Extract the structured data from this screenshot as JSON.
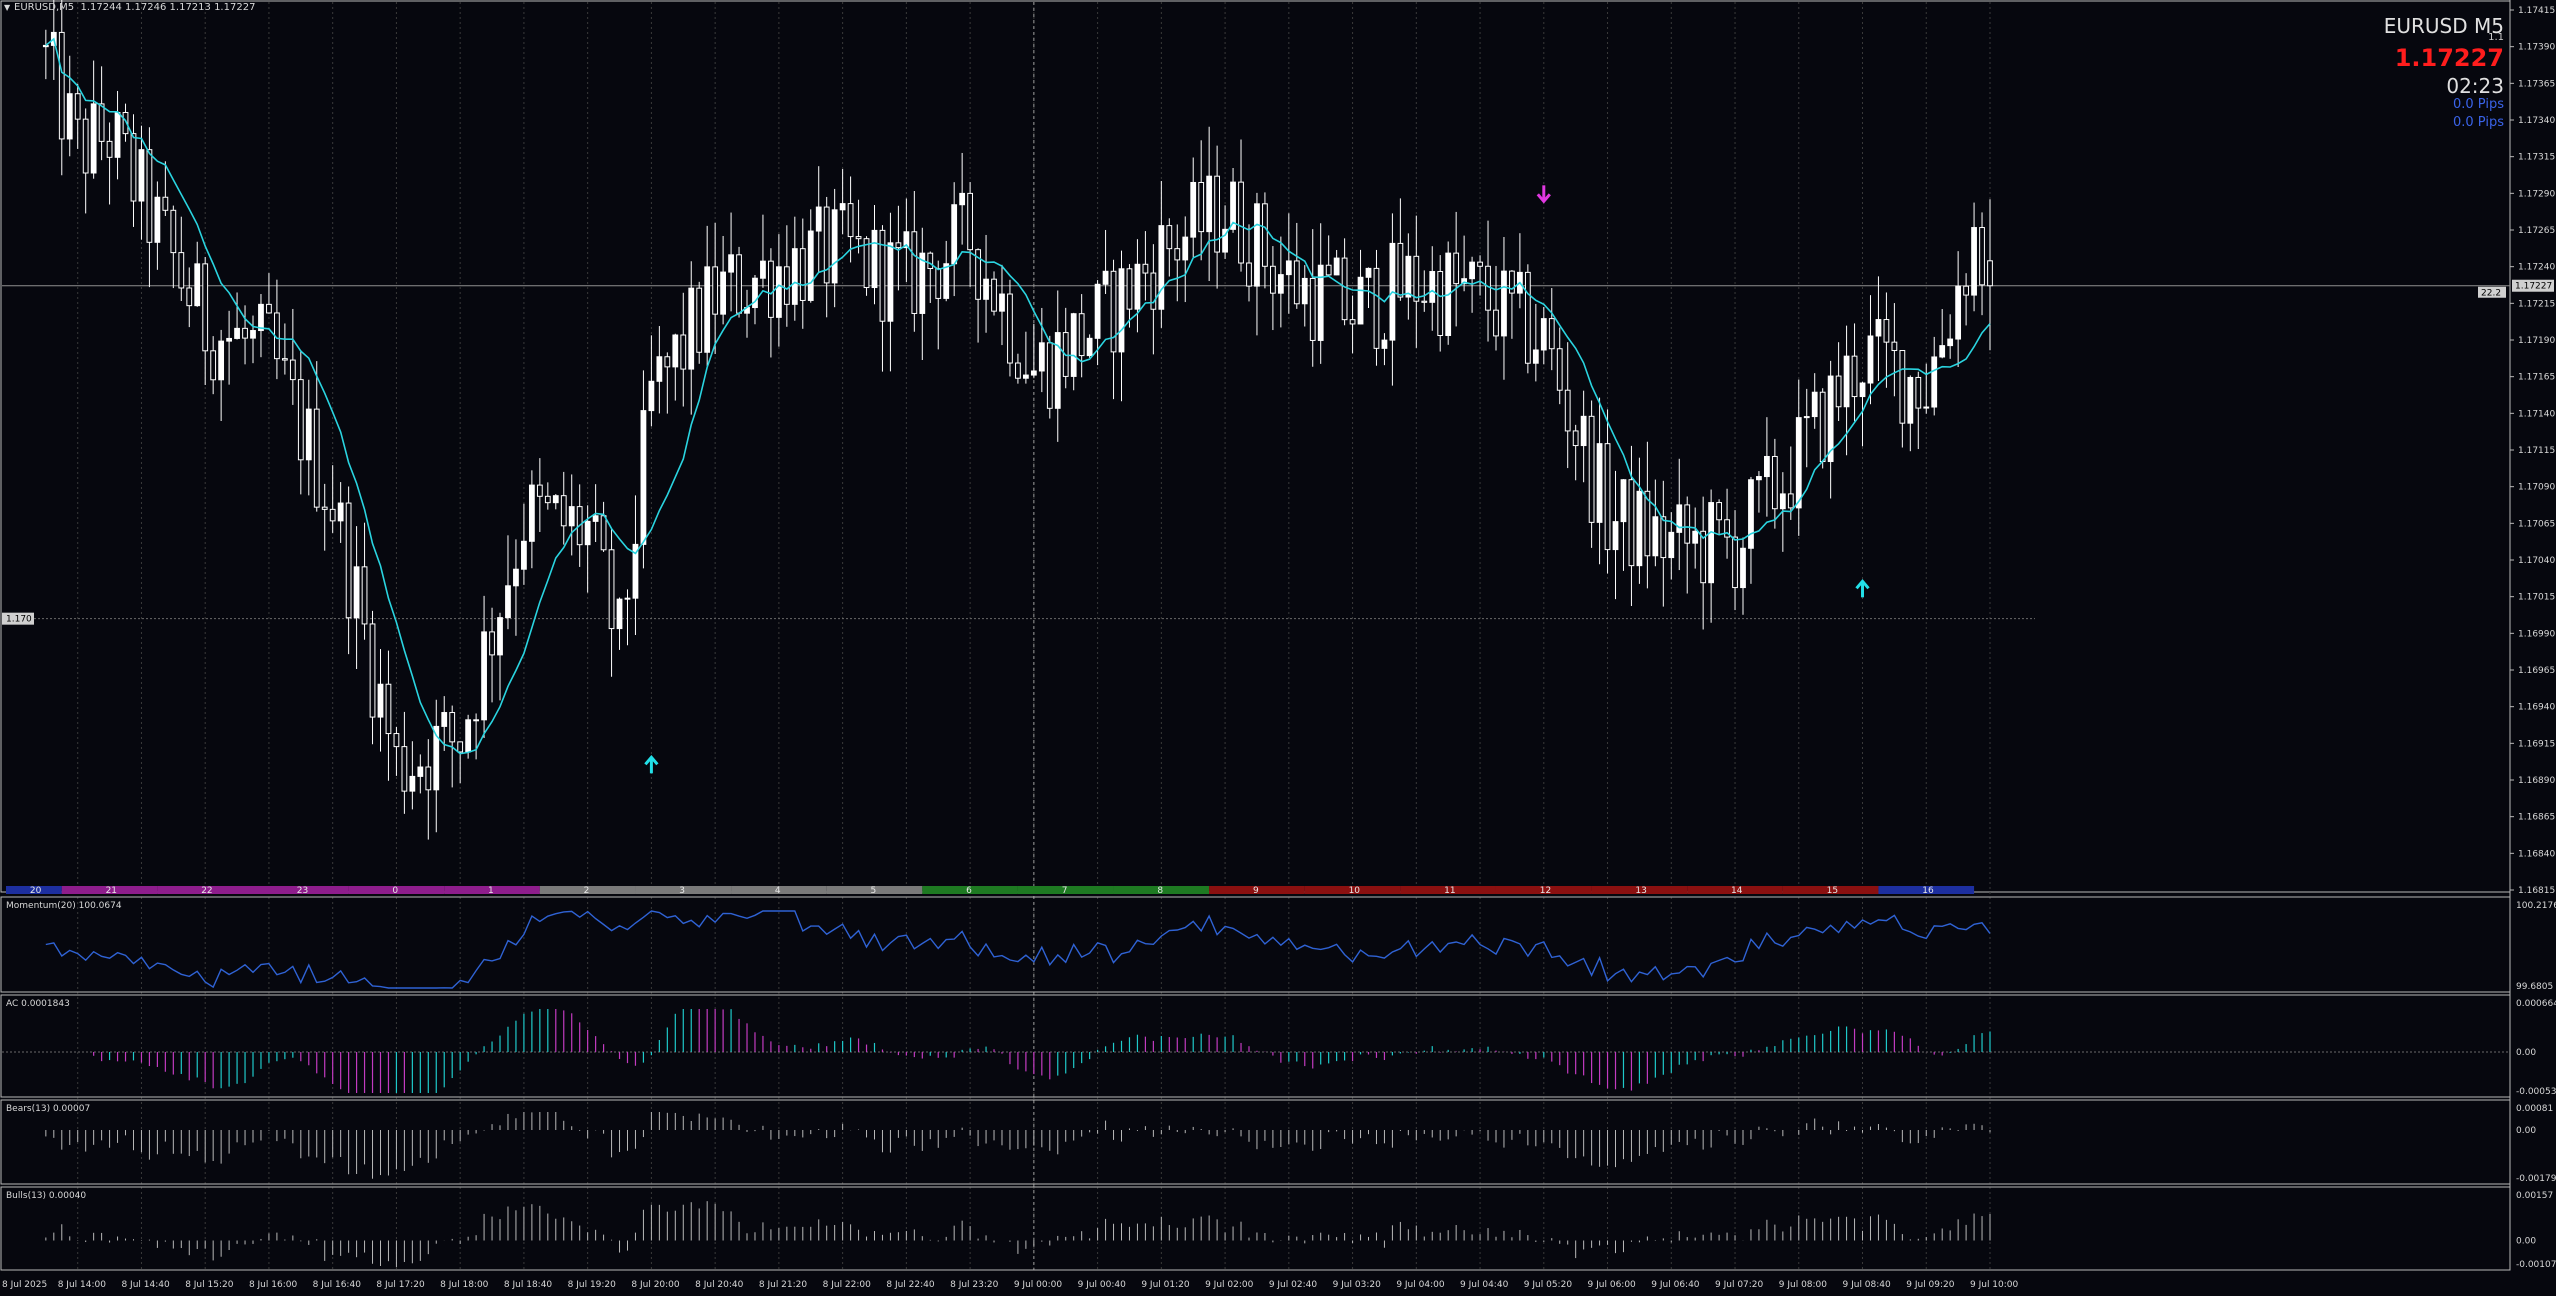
{
  "header": {
    "title": "EURUSD,M5  1.17244 1.17246 1.17213 1.17227"
  },
  "info_panel": {
    "symbol": "EURUSD   M5",
    "spread": "1.1",
    "bid": "1.17227",
    "countdown": "02:23",
    "pips_1": "0.0 Pips",
    "pips_2": "0.0 Pips"
  },
  "level_labels": {
    "horizontal_line": "1.170",
    "price_tag": "1.17227",
    "marker_tag": "22.2"
  },
  "price_axis_labels": [
    "1.17415",
    "1.17390",
    "1.17365",
    "1.17340",
    "1.17315",
    "1.17290",
    "1.17265",
    "1.17240",
    "1.17215",
    "1.17190",
    "1.17165",
    "1.17140",
    "1.17115",
    "1.17090",
    "1.17065",
    "1.17040",
    "1.17015",
    "1.16990",
    "1.16965",
    "1.16940",
    "1.16915",
    "1.16890",
    "1.16865",
    "1.16840",
    "1.16815"
  ],
  "time_axis_labels": [
    "8 Jul 2025",
    "8 Jul 14:00",
    "8 Jul 14:40",
    "8 Jul 15:20",
    "8 Jul 16:00",
    "8 Jul 16:40",
    "8 Jul 17:20",
    "8 Jul 18:00",
    "8 Jul 18:40",
    "8 Jul 19:20",
    "8 Jul 20:00",
    "8 Jul 20:40",
    "8 Jul 21:20",
    "8 Jul 22:00",
    "8 Jul 22:40",
    "8 Jul 23:20",
    "9 Jul 00:00",
    "9 Jul 00:40",
    "9 Jul 01:20",
    "9 Jul 02:00",
    "9 Jul 02:40",
    "9 Jul 03:20",
    "9 Jul 04:00",
    "9 Jul 04:40",
    "9 Jul 05:20",
    "9 Jul 06:00",
    "9 Jul 06:40",
    "9 Jul 07:20",
    "9 Jul 08:00",
    "9 Jul 08:40",
    "9 Jul 09:20",
    "9 Jul 10:00"
  ],
  "hour_bar": {
    "labels": [
      "20",
      "21",
      "22",
      "23",
      "0",
      "1",
      "2",
      "3",
      "4",
      "5",
      "6",
      "7",
      "8",
      "9",
      "10",
      "11",
      "12",
      "13",
      "14",
      "15",
      "16"
    ],
    "colors": [
      "#1d2fa0",
      "#8e1d8c",
      "#8e1d8c",
      "#8e1d8c",
      "#8e1d8c",
      "#8e1d8c",
      "#7a7a7a",
      "#7a7a7a",
      "#7a7a7a",
      "#7a7a7a",
      "#1e7a22",
      "#1e7a22",
      "#1e7a22",
      "#8b1010",
      "#8b1010",
      "#8b1010",
      "#8b1010",
      "#8b1010",
      "#8b1010",
      "#8b1010",
      "#1d2fa0"
    ]
  },
  "indicators": {
    "momentum": {
      "label": "Momentum(20) 100.0674",
      "scale_top": "100.2176",
      "scale_bottom": "99.6805"
    },
    "ac": {
      "label": "AC 0.0001843",
      "scale_top": "0.000664",
      "scale_zero": "0.00",
      "scale_bottom": "-0.000531"
    },
    "bears": {
      "label": "Bears(13) 0.00007",
      "scale_top": "0.00081",
      "scale_zero": "0.00",
      "scale_bottom": "-0.00179"
    },
    "bulls": {
      "label": "Bulls(13) 0.00040",
      "scale_top": "0.00157",
      "scale_zero": "0.00",
      "scale_bottom": "-0.00107"
    }
  },
  "colors": {
    "background": "#06070e",
    "bull_candle": "#ffffff",
    "bear_candle": "#ffffff",
    "moving_average": "#2ad4e0",
    "momentum_line": "#2f62d4",
    "ac_up": "#1fc9c9",
    "ac_down": "#c23bc0",
    "histogram": "#b8b8b8",
    "bid_text": "#ff1d1d",
    "sell_arrow": "#e038e0",
    "buy_arrow": "#22e0e8"
  },
  "chart_data": {
    "type": "candlestick",
    "symbol": "EURUSD",
    "timeframe": "M5",
    "last": {
      "open": 1.17244,
      "high": 1.17246,
      "low": 1.17213,
      "close": 1.17227
    },
    "ylim": [
      1.16815,
      1.17415
    ],
    "key_points": [
      {
        "t": "8 Jul 13:40",
        "price": 1.1738
      },
      {
        "t": "8 Jul 14:00",
        "price": 1.1732
      },
      {
        "t": "8 Jul 14:20",
        "price": 1.1733
      },
      {
        "t": "8 Jul 15:20",
        "price": 1.172
      },
      {
        "t": "8 Jul 16:00",
        "price": 1.1718
      },
      {
        "t": "8 Jul 16:40",
        "price": 1.1708
      },
      {
        "t": "8 Jul 17:20",
        "price": 1.169
      },
      {
        "t": "8 Jul 18:00",
        "price": 1.1692
      },
      {
        "t": "8 Jul 18:40",
        "price": 1.1707
      },
      {
        "t": "8 Jul 19:20",
        "price": 1.1706
      },
      {
        "t": "8 Jul 19:40",
        "price": 1.1698
      },
      {
        "t": "8 Jul 20:00",
        "price": 1.1715
      },
      {
        "t": "8 Jul 20:40",
        "price": 1.1722
      },
      {
        "t": "8 Jul 21:20",
        "price": 1.1724
      },
      {
        "t": "8 Jul 22:00",
        "price": 1.1725
      },
      {
        "t": "8 Jul 22:40",
        "price": 1.1723
      },
      {
        "t": "8 Jul 23:20",
        "price": 1.1726
      },
      {
        "t": "9 Jul 00:00",
        "price": 1.1717
      },
      {
        "t": "9 Jul 00:40",
        "price": 1.172
      },
      {
        "t": "9 Jul 01:20",
        "price": 1.1725
      },
      {
        "t": "9 Jul 02:00",
        "price": 1.1728
      },
      {
        "t": "9 Jul 02:40",
        "price": 1.1723
      },
      {
        "t": "9 Jul 03:20",
        "price": 1.1721
      },
      {
        "t": "9 Jul 04:00",
        "price": 1.1723
      },
      {
        "t": "9 Jul 04:40",
        "price": 1.1722
      },
      {
        "t": "9 Jul 05:20",
        "price": 1.1719
      },
      {
        "t": "9 Jul 06:00",
        "price": 1.1707
      },
      {
        "t": "9 Jul 06:40",
        "price": 1.1705
      },
      {
        "t": "9 Jul 07:20",
        "price": 1.1705
      },
      {
        "t": "9 Jul 08:00",
        "price": 1.1711
      },
      {
        "t": "9 Jul 08:40",
        "price": 1.1718
      },
      {
        "t": "9 Jul 09:20",
        "price": 1.1716
      },
      {
        "t": "9 Jul 09:50",
        "price": 1.1726
      },
      {
        "t": "9 Jul 10:00",
        "price": 1.17227
      }
    ],
    "signals": [
      {
        "type": "buy",
        "t": "8 Jul 20:00",
        "price": 1.169
      },
      {
        "type": "sell",
        "t": "9 Jul 05:20",
        "price": 1.1729
      },
      {
        "type": "buy",
        "t": "9 Jul 08:40",
        "price": 1.1702
      }
    ]
  }
}
